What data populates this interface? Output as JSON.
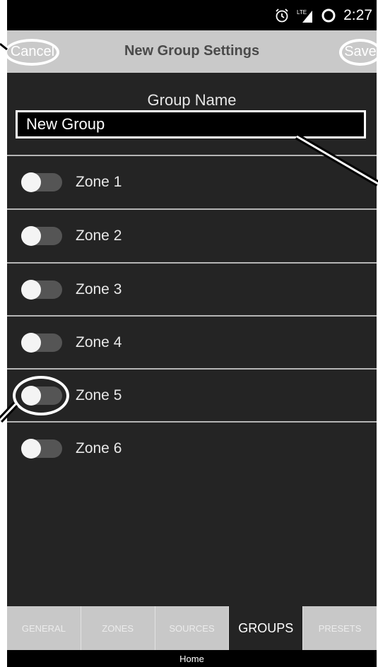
{
  "status_bar": {
    "alarm_icon": "alarm-clock-icon",
    "network_label": "LTE",
    "signal_icon": "signal-icon",
    "sync_icon": "ring-icon",
    "time": "2:27"
  },
  "nav_bar": {
    "cancel_label": "Cancel",
    "title": "New Group Settings",
    "save_label": "Save"
  },
  "group": {
    "label": "Group Name",
    "value": "New Group"
  },
  "zones": [
    {
      "label": "Zone 1",
      "enabled": false
    },
    {
      "label": "Zone 2",
      "enabled": false
    },
    {
      "label": "Zone 3",
      "enabled": false
    },
    {
      "label": "Zone 4",
      "enabled": false
    },
    {
      "label": "Zone 5",
      "enabled": false
    },
    {
      "label": "Zone 6",
      "enabled": false
    }
  ],
  "tabs": [
    {
      "label": "GENERAL",
      "active": false
    },
    {
      "label": "ZONES",
      "active": false
    },
    {
      "label": "SOURCES",
      "active": false
    },
    {
      "label": "GROUPS",
      "active": true
    },
    {
      "label": "PRESETS",
      "active": false
    }
  ],
  "home_label": "Home",
  "colors": {
    "background": "#242424",
    "nav_bar": "#c9c9c9",
    "tab_active": "#242424",
    "toggle_track": "#555555",
    "toggle_knob": "#f4f4f4"
  }
}
